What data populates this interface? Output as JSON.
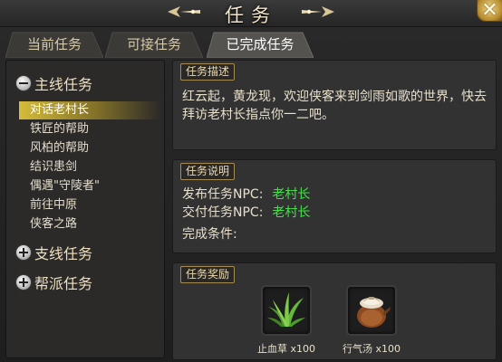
{
  "window": {
    "title": "任务"
  },
  "tabs": [
    {
      "label": "当前任务"
    },
    {
      "label": "可接任务"
    },
    {
      "label": "已完成任务"
    }
  ],
  "task_tree": {
    "main": {
      "label": "主线任务",
      "items": [
        "对话老村长",
        "铁匠的帮助",
        "风柏的帮助",
        "结识患剑",
        "偶遇\"守陵者\"",
        "前往中原",
        "侠客之路"
      ],
      "selected_index": 0
    },
    "side": {
      "label": "支线任务"
    },
    "faction": {
      "label": "帮派任务"
    }
  },
  "description": {
    "tag": "任务描述",
    "text": "红云起，黄龙现，欢迎侠客来到剑雨如歌的世界，快去拜访老村长指点你一二吧。"
  },
  "explanation": {
    "tag": "任务说明",
    "issuer_label": "发布任务NPC:",
    "issuer_value": "老村长",
    "submit_label": "交付任务NPC:",
    "submit_value": "老村长",
    "condition_label": "完成条件:"
  },
  "rewards": {
    "tag": "任务奖励",
    "items": [
      {
        "name": "止血草 x100",
        "icon": "herb-icon"
      },
      {
        "name": "行气汤 x100",
        "icon": "soup-pot-icon"
      }
    ]
  },
  "colors": {
    "npc": "#44e04a",
    "selected": "#dec43c",
    "accent": "#a58a53"
  }
}
